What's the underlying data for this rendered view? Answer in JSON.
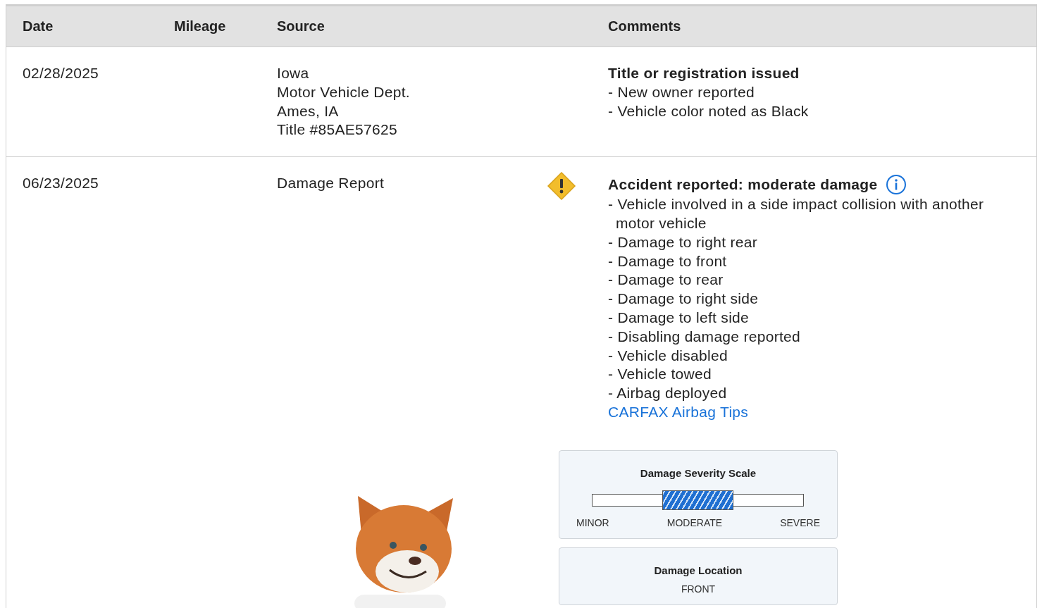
{
  "table": {
    "columns": [
      "Date",
      "Mileage",
      "Source",
      "Comments"
    ],
    "rows": [
      {
        "date": "02/28/2025",
        "source": [
          "Iowa",
          "Motor Vehicle Dept.",
          "Ames, IA",
          "Title #85AE57625"
        ],
        "title": "Title or registration issued",
        "details": [
          "- New owner reported",
          "- Vehicle color noted as Black"
        ]
      },
      {
        "date": "06/23/2025",
        "source": [
          "Damage Report"
        ],
        "alert": true,
        "info": true,
        "title": "Accident reported: moderate damage",
        "details": [
          "- Vehicle involved in a side impact collision with another motor vehicle",
          "- Damage to right rear",
          "- Damage to front",
          "- Damage to rear",
          "- Damage to right side",
          "- Damage to left side",
          "- Disabling damage reported",
          "- Vehicle disabled",
          "- Vehicle towed",
          "- Airbag deployed"
        ],
        "link": "CARFAX Airbag Tips",
        "severity": {
          "title": "Damage Severity Scale",
          "levels": [
            {
              "label": "MINOR",
              "selected": false
            },
            {
              "label": "MODERATE",
              "selected": true
            },
            {
              "label": "SEVERE",
              "selected": false
            }
          ]
        },
        "location": {
          "title": "Damage Location",
          "value": "FRONT"
        }
      }
    ]
  }
}
